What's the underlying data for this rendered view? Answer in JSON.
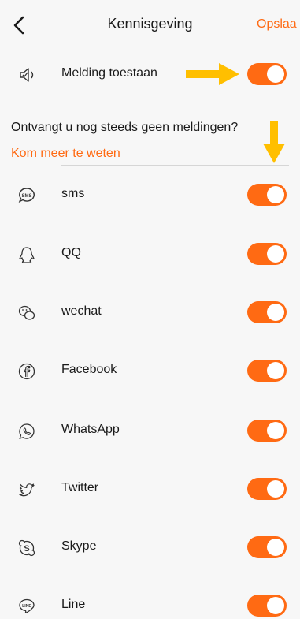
{
  "header": {
    "title": "Kennisgeving",
    "save_label": "Opslaa"
  },
  "master": {
    "label": "Melding toestaan",
    "icon": "speaker-icon",
    "enabled": true
  },
  "help": {
    "question": "Ontvangt u nog steeds geen meldingen?",
    "link": "Kom meer te weten"
  },
  "apps": [
    {
      "label": "sms",
      "icon": "sms-icon",
      "enabled": true
    },
    {
      "label": "QQ",
      "icon": "qq-icon",
      "enabled": true
    },
    {
      "label": "wechat",
      "icon": "wechat-icon",
      "enabled": true
    },
    {
      "label": "Facebook",
      "icon": "facebook-icon",
      "enabled": true
    },
    {
      "label": "WhatsApp",
      "icon": "whatsapp-icon",
      "enabled": true
    },
    {
      "label": "Twitter",
      "icon": "twitter-icon",
      "enabled": true
    },
    {
      "label": "Skype",
      "icon": "skype-icon",
      "enabled": true
    },
    {
      "label": "Line",
      "icon": "line-icon",
      "enabled": true
    }
  ],
  "colors": {
    "accent": "#ff6a13",
    "annotation_arrow": "#ffbf00",
    "background": "#f7f7f7"
  }
}
